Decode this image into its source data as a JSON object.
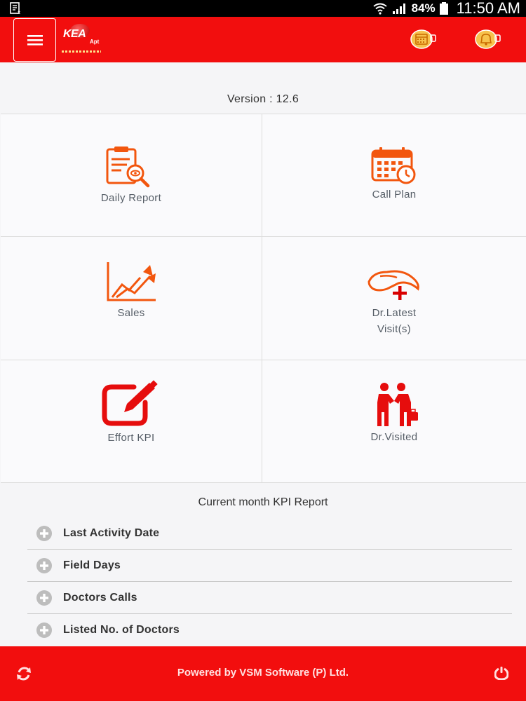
{
  "status_bar": {
    "battery_percent": "84%",
    "time": "11:50 AM",
    "icons": [
      "sim-icon",
      "wifi-icon",
      "signal-icon",
      "battery-icon"
    ]
  },
  "app_bar": {
    "logo_text": "KEA",
    "logo_subtext": "Apt",
    "icons": [
      "menu-icon",
      "calendar-icon",
      "bell-icon"
    ]
  },
  "version_text": "Version : 12.6",
  "tiles": [
    {
      "label": "Daily Report",
      "icon": "report-search-icon"
    },
    {
      "label": "Call Plan",
      "icon": "calendar-clock-icon"
    },
    {
      "label": "Sales",
      "icon": "growth-chart-icon"
    },
    {
      "label_line1": "Dr.Latest",
      "label_line2": "Visit(s)",
      "icon": "hand-plus-icon"
    },
    {
      "label": "Effort KPI",
      "icon": "edit-square-icon"
    },
    {
      "label": "Dr.Visited",
      "icon": "handshake-icon"
    }
  ],
  "kpi": {
    "title": "Current month KPI Report",
    "items": [
      "Last Activity Date",
      "Field Days",
      "Doctors Calls",
      "Listed No. of Doctors"
    ]
  },
  "footer": {
    "text": "Powered by VSM Software (P) Ltd.",
    "icons": [
      "refresh-icon",
      "power-icon"
    ]
  },
  "colors": {
    "brand_red": "#f20e0e",
    "icon_orange": "#f2560e",
    "label_gray": "#555d66"
  }
}
